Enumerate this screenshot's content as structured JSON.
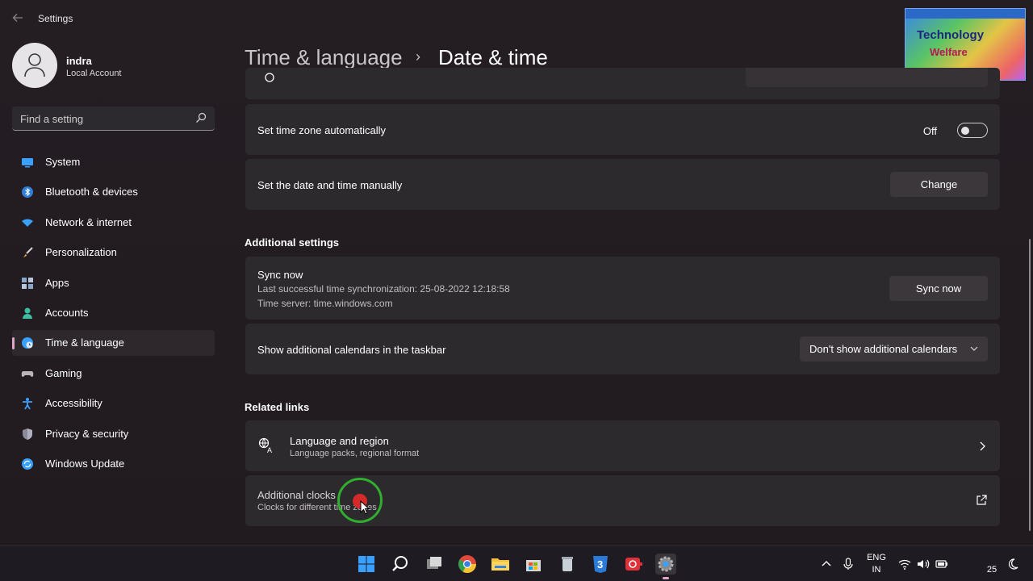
{
  "app": {
    "title": "Settings"
  },
  "watermark": {
    "line1": "Technology",
    "line2": "Welfare"
  },
  "user": {
    "name": "indra",
    "account_type": "Local Account"
  },
  "search": {
    "placeholder": "Find a setting"
  },
  "sidebar": {
    "items": [
      {
        "label": "System",
        "icon": "system-icon",
        "color": "#3aa0ff"
      },
      {
        "label": "Bluetooth & devices",
        "icon": "bluetooth-icon",
        "color": "#3aa0ff"
      },
      {
        "label": "Network & internet",
        "icon": "wifi-icon",
        "color": "#3aa0ff"
      },
      {
        "label": "Personalization",
        "icon": "brush-icon",
        "color": "#f0a040"
      },
      {
        "label": "Apps",
        "icon": "apps-icon",
        "color": "#8aa6c8"
      },
      {
        "label": "Accounts",
        "icon": "person-icon",
        "color": "#3ac0a0"
      },
      {
        "label": "Time & language",
        "icon": "globe-clock-icon",
        "color": "#3aa0ff",
        "active": true
      },
      {
        "label": "Gaming",
        "icon": "controller-icon",
        "color": "#b8b4b8"
      },
      {
        "label": "Accessibility",
        "icon": "accessibility-icon",
        "color": "#3aa0ff"
      },
      {
        "label": "Privacy & security",
        "icon": "shield-icon",
        "color": "#8a8a9a"
      },
      {
        "label": "Windows Update",
        "icon": "update-icon",
        "color": "#3aa0ff"
      }
    ]
  },
  "breadcrumb": {
    "parent": "Time & language",
    "separator": "›",
    "current": "Date & time"
  },
  "settings": {
    "timezone_auto": {
      "label": "Set time zone automatically",
      "state": "Off"
    },
    "manual": {
      "label": "Set the date and time manually",
      "button": "Change"
    }
  },
  "additional": {
    "title": "Additional settings",
    "sync": {
      "label": "Sync now",
      "last_sync": "Last successful time synchronization: 25-08-2022 12:18:58",
      "server": "Time server: time.windows.com",
      "button": "Sync now"
    },
    "calendars": {
      "label": "Show additional calendars in the taskbar",
      "selected": "Don't show additional calendars"
    }
  },
  "related": {
    "title": "Related links",
    "language": {
      "label": "Language and region",
      "sub": "Language packs, regional format"
    },
    "clocks": {
      "label": "Additional clocks",
      "sub": "Clocks for different time zones"
    }
  },
  "taskbar": {
    "lang_line1": "ENG",
    "lang_line2": "IN",
    "time_fragment": "25",
    "accent": "#e0a7c9"
  }
}
